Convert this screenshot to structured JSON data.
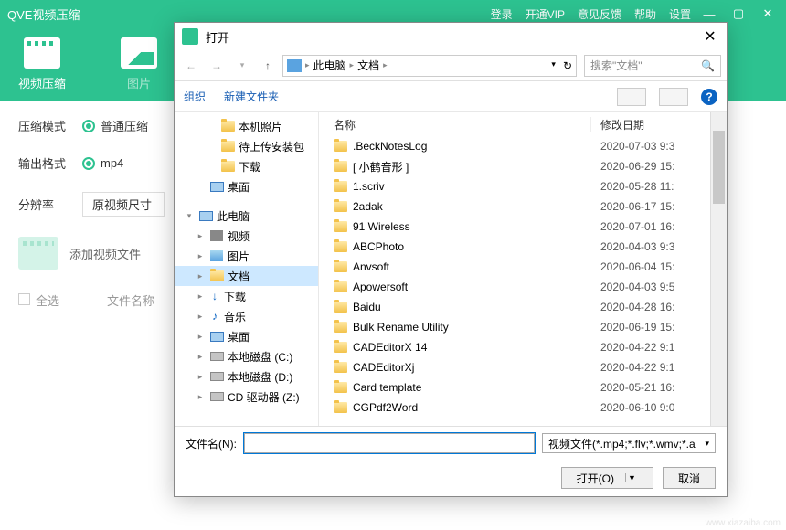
{
  "app": {
    "title": "QVE视频压缩",
    "menu": {
      "login": "登录",
      "vip": "开通VIP",
      "feedback": "意见反馈",
      "help": "帮助",
      "settings": "设置"
    }
  },
  "tabs": {
    "video": "视频压缩",
    "image": "图片"
  },
  "options": {
    "mode_label": "压缩模式",
    "mode_value": "普通压缩",
    "format_label": "输出格式",
    "format_value": "mp4",
    "resolution_label": "分辨率",
    "resolution_value": "原视频尺寸"
  },
  "add_files_label": "添加视频文件",
  "select_all_label": "全选",
  "filename_col": "文件名称",
  "dialog": {
    "title": "打开",
    "breadcrumb": {
      "root": "此电脑",
      "current": "文档"
    },
    "search_placeholder": "搜索\"文档\"",
    "toolbar": {
      "organize": "组织",
      "newfolder": "新建文件夹"
    },
    "tree": [
      {
        "label": "本机照片",
        "arrow": "",
        "indent": 26,
        "icon": "folder"
      },
      {
        "label": "待上传安装包",
        "arrow": "",
        "indent": 26,
        "icon": "folder"
      },
      {
        "label": "下载",
        "arrow": "",
        "indent": 26,
        "icon": "folder"
      },
      {
        "label": "桌面",
        "arrow": "",
        "indent": 14,
        "icon": "monitor"
      },
      {
        "label": "",
        "arrow": "",
        "indent": 0,
        "icon": "",
        "spacer": true
      },
      {
        "label": "此电脑",
        "arrow": "▾",
        "indent": 2,
        "icon": "monitor"
      },
      {
        "label": "视频",
        "arrow": "▸",
        "indent": 14,
        "icon": "video"
      },
      {
        "label": "图片",
        "arrow": "▸",
        "indent": 14,
        "icon": "image"
      },
      {
        "label": "文档",
        "arrow": "▸",
        "indent": 14,
        "icon": "folder",
        "selected": true
      },
      {
        "label": "下载",
        "arrow": "▸",
        "indent": 14,
        "icon": "download"
      },
      {
        "label": "音乐",
        "arrow": "▸",
        "indent": 14,
        "icon": "music"
      },
      {
        "label": "桌面",
        "arrow": "▸",
        "indent": 14,
        "icon": "monitor"
      },
      {
        "label": "本地磁盘 (C:)",
        "arrow": "▸",
        "indent": 14,
        "icon": "drive"
      },
      {
        "label": "本地磁盘 (D:)",
        "arrow": "▸",
        "indent": 14,
        "icon": "drive"
      },
      {
        "label": "CD 驱动器 (Z:)",
        "arrow": "▸",
        "indent": 14,
        "icon": "drive"
      }
    ],
    "columns": {
      "name": "名称",
      "date": "修改日期"
    },
    "files": [
      {
        "name": ".BeckNotesLog",
        "date": "2020-07-03 9:3"
      },
      {
        "name": "[ 小鹤音形 ]",
        "date": "2020-06-29 15:"
      },
      {
        "name": "1.scriv",
        "date": "2020-05-28 11:"
      },
      {
        "name": "2adak",
        "date": "2020-06-17 15:"
      },
      {
        "name": "91 Wireless",
        "date": "2020-07-01 16:"
      },
      {
        "name": "ABCPhoto",
        "date": "2020-04-03 9:3"
      },
      {
        "name": "Anvsoft",
        "date": "2020-06-04 15:"
      },
      {
        "name": "Apowersoft",
        "date": "2020-04-03 9:5"
      },
      {
        "name": "Baidu",
        "date": "2020-04-28 16:"
      },
      {
        "name": "Bulk Rename Utility",
        "date": "2020-06-19 15:"
      },
      {
        "name": "CADEditorX 14",
        "date": "2020-04-22 9:1"
      },
      {
        "name": "CADEditorXj",
        "date": "2020-04-22 9:1"
      },
      {
        "name": "Card template",
        "date": "2020-05-21 16:"
      },
      {
        "name": "CGPdf2Word",
        "date": "2020-06-10 9:0"
      }
    ],
    "filename_label": "文件名(N):",
    "filter": "视频文件(*.mp4;*.flv;*.wmv;*.a",
    "open_btn": "打开(O)",
    "cancel_btn": "取消"
  },
  "watermark": "www.xiazaiba.com"
}
